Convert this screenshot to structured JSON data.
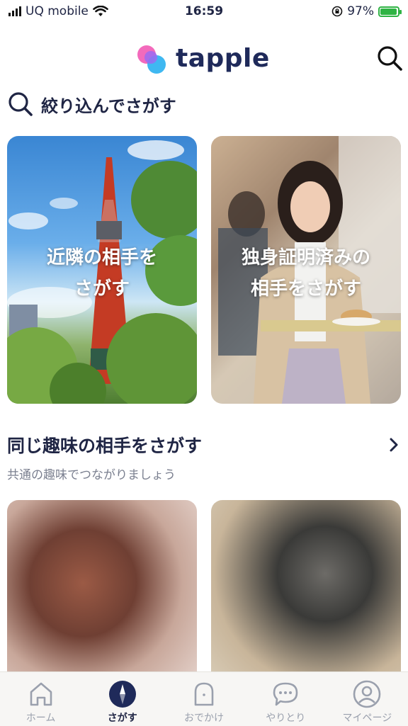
{
  "status_bar": {
    "carrier": "UQ mobile",
    "time": "16:59",
    "battery_percent": "97%",
    "battery_level": 0.97
  },
  "header": {
    "app_name": "tapple",
    "search_icon": "search-icon"
  },
  "filter": {
    "label": "絞り込んでさがす",
    "icon": "search-icon"
  },
  "cards": [
    {
      "line1": "近隣の相手を",
      "line2": "さがす"
    },
    {
      "line1": "独身証明済みの",
      "line2": "相手をさがす"
    }
  ],
  "hobby_section": {
    "title": "同じ趣味の相手をさがす",
    "subtitle": "共通の趣味でつながりましょう",
    "chevron_icon": "chevron-right-icon"
  },
  "tabs": [
    {
      "label": "ホーム",
      "icon": "home-icon"
    },
    {
      "label": "さがす",
      "icon": "compass-icon",
      "active": true
    },
    {
      "label": "おでかけ",
      "icon": "ghost-icon"
    },
    {
      "label": "やりとり",
      "icon": "chat-bubble-icon"
    },
    {
      "label": "マイページ",
      "icon": "user-icon"
    }
  ],
  "colors": {
    "primary_text": "#1f2544",
    "battery_green": "#2fb344",
    "inactive_tab": "#9aa0ad"
  }
}
